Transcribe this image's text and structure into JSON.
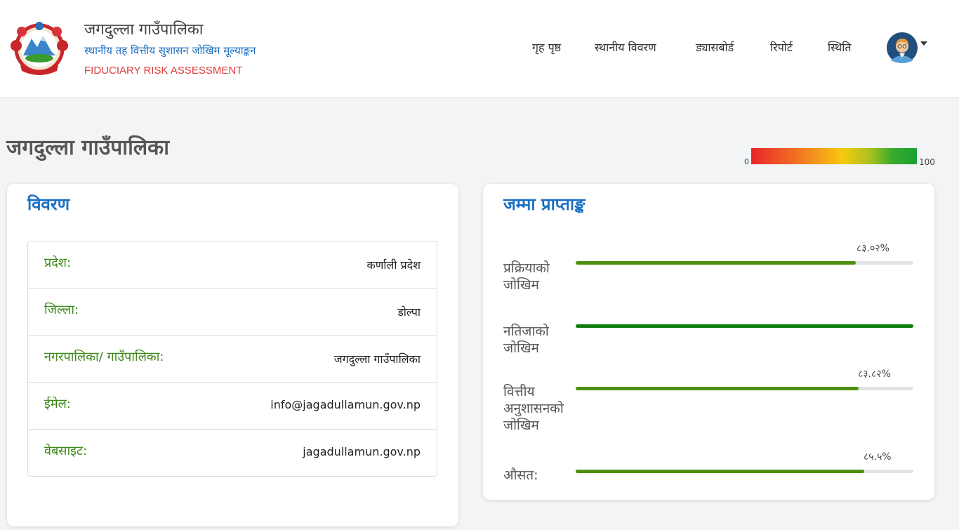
{
  "header": {
    "title": "जगदुल्ला गाउँपालिका",
    "subtitle": "स्थानीय तह वित्तीय सुशासन जोखिम मूल्याङ्कन",
    "subtitle_en": "FIDUCIARY RISK ASSESSMENT",
    "nav": [
      "गृह पृष्ठ",
      "स्थानीय विवरण",
      "ड्यासबोर्ड",
      "रिपोर्ट",
      "स्थिति"
    ]
  },
  "page_title": "जगदुल्ला गाउँपालिका",
  "legend": {
    "min": "0",
    "max": "100"
  },
  "details": {
    "title": "विवरण",
    "rows": [
      {
        "label": "प्रदेश:",
        "value": "कर्णाली प्रदेश"
      },
      {
        "label": "जिल्ला:",
        "value": "डोल्पा"
      },
      {
        "label": "नगरपालिका/ गाउँपालिका:",
        "value": "जगदुल्ला गाउँपालिका"
      },
      {
        "label": "ईमेल:",
        "value": "info@jagadullamun.gov.np"
      },
      {
        "label": "वेबसाइट:",
        "value": "jagadullamun.gov.np"
      }
    ]
  },
  "score": {
    "title": "जम्मा प्राप्ताङ्क",
    "items": [
      {
        "label_lines": [
          "प्रक्रियाको",
          "जोखिम"
        ],
        "percent_text": "८३.०२%",
        "value": 83.02,
        "color": "#4e8f0f"
      },
      {
        "label_lines": [
          "नतिजाको",
          "जोखिम"
        ],
        "percent_text": "",
        "value": 100,
        "color": "#0f7d10"
      },
      {
        "label_lines": [
          "वित्तीय",
          "अनुशासनको",
          "जोखिम"
        ],
        "percent_text": "८३.८२%",
        "value": 83.82,
        "color": "#4e8f0f"
      },
      {
        "label_lines": [
          "औसत:"
        ],
        "percent_text": "८५.५%",
        "value": 85.5,
        "color": "#4e8f0f"
      }
    ]
  },
  "colors": {
    "accent": "#1a6fc4",
    "label_green": "#3e8a1a",
    "brand_red": "#e03a3a"
  },
  "icons": {
    "emblem": "nepal-emblem-icon",
    "avatar": "user-avatar-icon",
    "caret": "caret-down-icon"
  }
}
